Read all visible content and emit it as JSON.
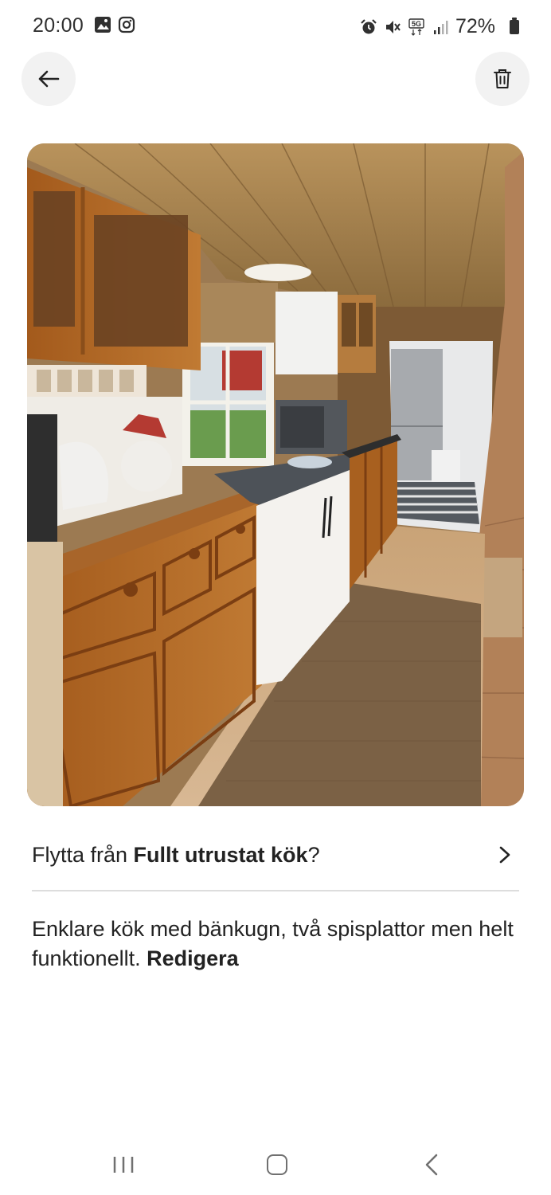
{
  "status_bar": {
    "time": "20:00",
    "battery": "72%",
    "network": "5G",
    "left_icons": [
      "gallery-icon",
      "instagram-icon"
    ],
    "right_icons": [
      "alarm-icon",
      "mute-icon",
      "5g-icon",
      "signal-icon",
      "battery-icon"
    ]
  },
  "header": {
    "back_icon": "arrow-left-icon",
    "delete_icon": "trash-icon"
  },
  "photo": {
    "subject": "kitchen"
  },
  "move": {
    "prefix": "Flytta från ",
    "target": "Fullt utrustat kök",
    "suffix": "?"
  },
  "caption": {
    "text": "Enklare kök med bänkugn, två spisplattor men helt funktionellt. ",
    "edit_label": "Redigera"
  },
  "nav_bar": {
    "icons": [
      "recent-apps-icon",
      "home-icon",
      "back-icon"
    ]
  },
  "colors": {
    "text": "#222222",
    "button_bg": "#f2f2f2",
    "divider": "#dddddd"
  }
}
